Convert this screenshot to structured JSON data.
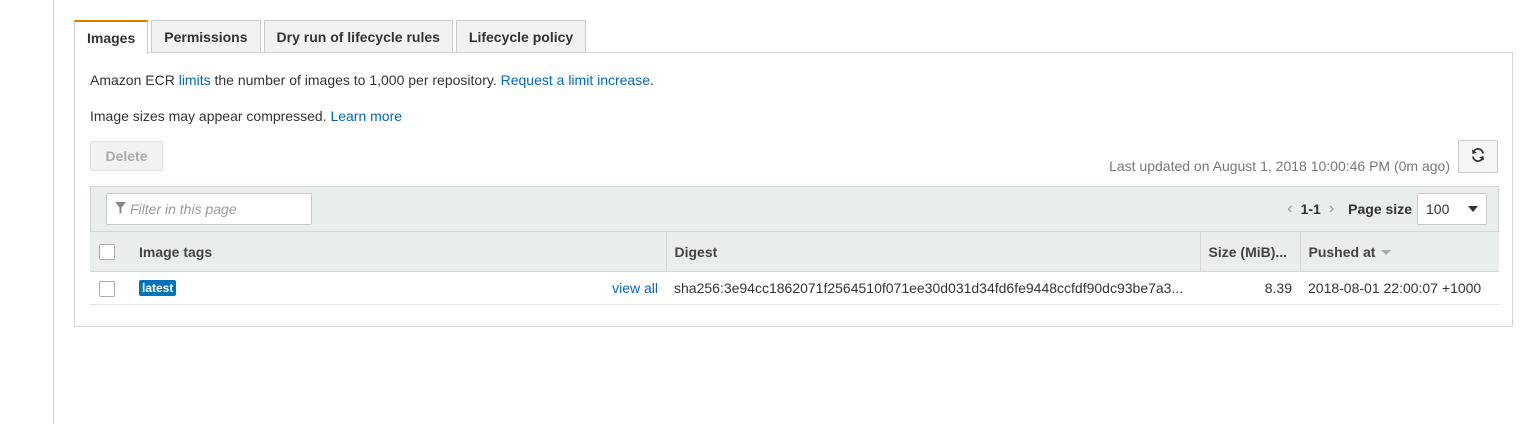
{
  "tabs": [
    {
      "label": "Images",
      "active": true
    },
    {
      "label": "Permissions",
      "active": false
    },
    {
      "label": "Dry run of lifecycle rules",
      "active": false
    },
    {
      "label": "Lifecycle policy",
      "active": false
    }
  ],
  "info": {
    "limit_prefix": "Amazon ECR ",
    "limit_link": "limits",
    "limit_mid": " the number of images to 1,000 per repository. ",
    "limit_increase_link": "Request a limit increase",
    "limit_suffix": ".",
    "sizes_text": "Image sizes may appear compressed. ",
    "learn_more_link": "Learn more"
  },
  "toolbar": {
    "delete_label": "Delete",
    "last_updated": "Last updated on August 1, 2018 10:00:46 PM (0m ago)",
    "refresh_icon": "refresh-icon"
  },
  "filter": {
    "placeholder": "Filter in this page",
    "icon": "filter-icon"
  },
  "pagination": {
    "prev": "‹",
    "range": "1-1",
    "next": "›",
    "page_size_label": "Page size",
    "page_size_value": "100"
  },
  "table": {
    "columns": [
      "Image tags",
      "Digest",
      "Size (MiB)...",
      "Pushed at"
    ],
    "sorted_column": "Pushed at",
    "rows": [
      {
        "tag": "latest",
        "view_all": "view all",
        "digest": "sha256:3e94cc1862071f2564510f071ee30d031d34fd6fe9448ccfdf90dc93be7a3...",
        "size": "8.39",
        "pushed_at": "2018-08-01 22:00:07 +1000"
      }
    ]
  },
  "colors": {
    "active_tab_accent": "#e07b00",
    "link": "#0066c0",
    "tag_badge": "#0073bb"
  }
}
